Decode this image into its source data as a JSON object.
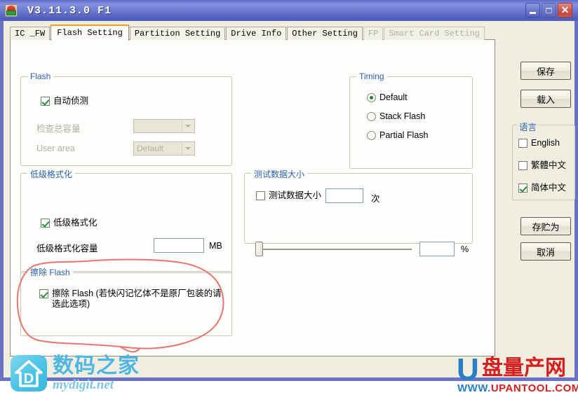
{
  "window": {
    "title": "V3.11.3.0 F1",
    "icon": "app-icon",
    "minimize_label": "",
    "maximize_label": "",
    "close_label": "✕"
  },
  "tabs": [
    {
      "label": "IC _FW",
      "state": "normal"
    },
    {
      "label": "Flash Setting",
      "state": "active"
    },
    {
      "label": "Partition Setting",
      "state": "normal"
    },
    {
      "label": "Drive Info",
      "state": "normal"
    },
    {
      "label": "Other Setting",
      "state": "normal"
    },
    {
      "label": "FP",
      "state": "disabled"
    },
    {
      "label": "Smart Card Setting",
      "state": "disabled"
    }
  ],
  "flash_group": {
    "title": "Flash",
    "auto_detect": {
      "label": "自动侦测",
      "checked": true
    },
    "total_capacity": {
      "label": "检查总容量",
      "value": "",
      "enabled": false
    },
    "user_area": {
      "label": "User area",
      "value": "Default",
      "enabled": false
    }
  },
  "timing_group": {
    "title": "Timing",
    "options": [
      {
        "label": "Default",
        "selected": true
      },
      {
        "label": "Stack Flash",
        "selected": false
      },
      {
        "label": "Partial Flash",
        "selected": false
      }
    ]
  },
  "lowlevel_group": {
    "title": "低级格式化",
    "enable": {
      "label": "低级格式化",
      "checked": true
    },
    "capacity": {
      "label": "低级格式化容量",
      "value": "",
      "unit": "MB"
    }
  },
  "testsize_group": {
    "title": "测试数据大小",
    "enable": {
      "label": "测试数据大小",
      "checked": false
    },
    "count": {
      "value": "",
      "unit": "次"
    },
    "percent": {
      "value": "",
      "unit": "%",
      "slider_position": 0
    }
  },
  "erase_group": {
    "title": "擦除 Flash",
    "erase": {
      "label": "擦除 Flash (若快闪记忆体不是原厂包装的请选此选项)",
      "checked": true
    }
  },
  "sidebar": {
    "save_button": "保存",
    "load_button": "载入",
    "language_group": {
      "title": "语言",
      "options": [
        {
          "label": "English",
          "checked": false
        },
        {
          "label": "繁體中文",
          "checked": false
        },
        {
          "label": "简体中文",
          "checked": true
        }
      ]
    },
    "save_as_button": "存贮为",
    "cancel_button": "取消"
  },
  "watermarks": {
    "left": {
      "cn": "数码之家",
      "en": "mydigit.net",
      "logo_letter": "D"
    },
    "right": {
      "mark": "U",
      "cn": "盘量产网",
      "url_prefix": "WWW.",
      "url_main": "UPANTOOL",
      "url_suffix": ".COM"
    }
  },
  "colors": {
    "titlebar": "#6d7ad0",
    "panel": "#efeee1",
    "tabpage": "#fdfdfb",
    "group_title": "#2a5fb0",
    "active_tab_accent": "#f0a017",
    "annotation": "#e8756f",
    "check": "#1e9431"
  }
}
